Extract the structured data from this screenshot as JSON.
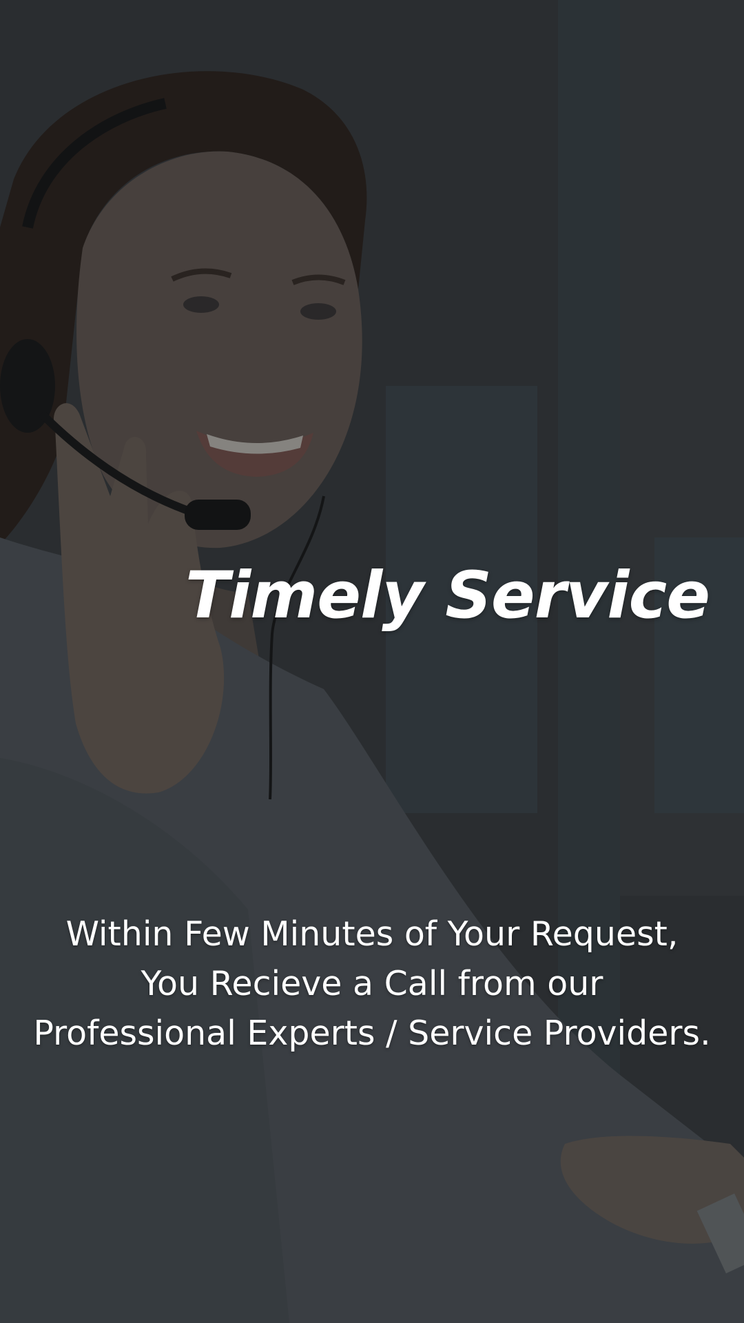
{
  "screen": {
    "headline": "Timely Service",
    "description_lines": [
      "Within Few Minutes of Your Request,",
      "You Recieve a Call from our",
      "Professional Experts / Service Providers."
    ]
  },
  "background": {
    "image": "customer-support-agent-photo",
    "overlay_color": "#2b2e31"
  }
}
